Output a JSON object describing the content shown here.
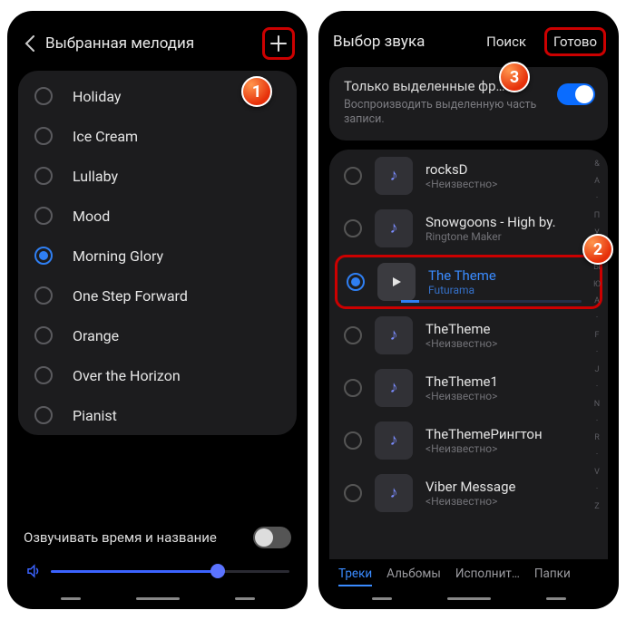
{
  "left": {
    "title": "Выбранная мелодия",
    "items": [
      {
        "label": "Holiday",
        "selected": false
      },
      {
        "label": "Ice Cream",
        "selected": false
      },
      {
        "label": "Lullaby",
        "selected": false
      },
      {
        "label": "Mood",
        "selected": false
      },
      {
        "label": "Morning Glory",
        "selected": true
      },
      {
        "label": "One Step Forward",
        "selected": false
      },
      {
        "label": "Orange",
        "selected": false
      },
      {
        "label": "Over the Horizon",
        "selected": false
      },
      {
        "label": "Pianist",
        "selected": false
      }
    ],
    "announce_label": "Озвучивать время и название",
    "announce_on": false,
    "volume_percent": 70
  },
  "right": {
    "title": "Выбор звука",
    "search_label": "Поиск",
    "done_label": "Готово",
    "highlight_title": "Только выделенные фр…",
    "highlight_sub": "Воспроизводить выделенную часть записи.",
    "highlight_on": true,
    "tracks": [
      {
        "name": "rocksD",
        "artist": "<Неизвестно>",
        "selected": false
      },
      {
        "name": "Snowgoons - High by.",
        "artist": "Ringtone Maker",
        "selected": false
      },
      {
        "name": "The Theme",
        "artist": "Futurama",
        "selected": true
      },
      {
        "name": "TheTheme",
        "artist": "<Неизвестно>",
        "selected": false
      },
      {
        "name": "TheTheme1",
        "artist": "<Неизвестно>",
        "selected": false
      },
      {
        "name": "TheThemeРингтон",
        "artist": "<Неизвестно>",
        "selected": false
      },
      {
        "name": "Viber Message",
        "artist": "<Неизвестно>",
        "selected": false
      }
    ],
    "tabs": [
      {
        "label": "Треки",
        "active": true
      },
      {
        "label": "Альбомы",
        "active": false
      },
      {
        "label": "Исполнит…",
        "active": false
      },
      {
        "label": "Папки",
        "active": false
      }
    ],
    "index_letters": [
      "&",
      "А",
      "*",
      "П",
      "У",
      "*",
      "Ы",
      "Ю",
      "А",
      "*",
      "F",
      "*",
      "J",
      "*",
      "N",
      "*",
      "R",
      "*",
      "V",
      "*",
      "Z"
    ]
  },
  "callouts": {
    "1": "1",
    "2": "2",
    "3": "3"
  }
}
